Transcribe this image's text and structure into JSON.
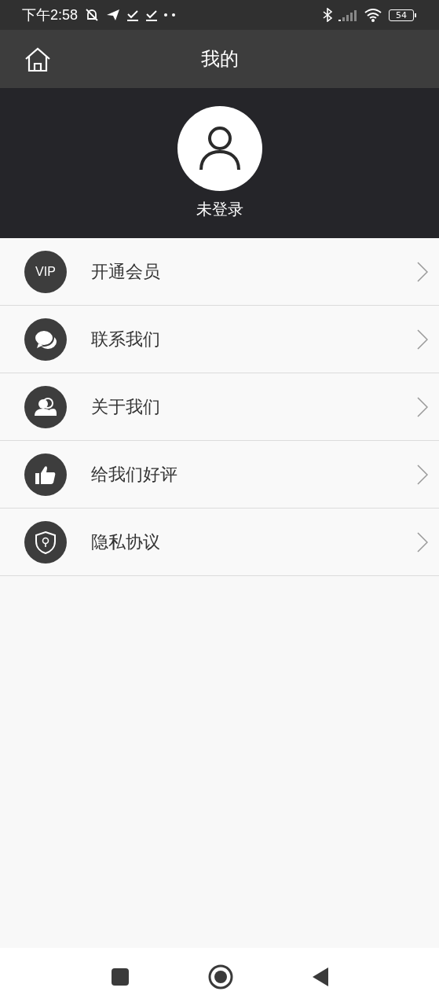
{
  "status_bar": {
    "time": "下午2:58",
    "battery": "54"
  },
  "header": {
    "title": "我的"
  },
  "profile": {
    "name": "未登录"
  },
  "menu": [
    {
      "kind": "vip",
      "badge": "VIP",
      "label": "开通会员"
    },
    {
      "kind": "chat",
      "label": "联系我们"
    },
    {
      "kind": "people",
      "label": "关于我们"
    },
    {
      "kind": "thumb",
      "label": "给我们好评"
    },
    {
      "kind": "shield",
      "label": "隐私协议"
    }
  ]
}
